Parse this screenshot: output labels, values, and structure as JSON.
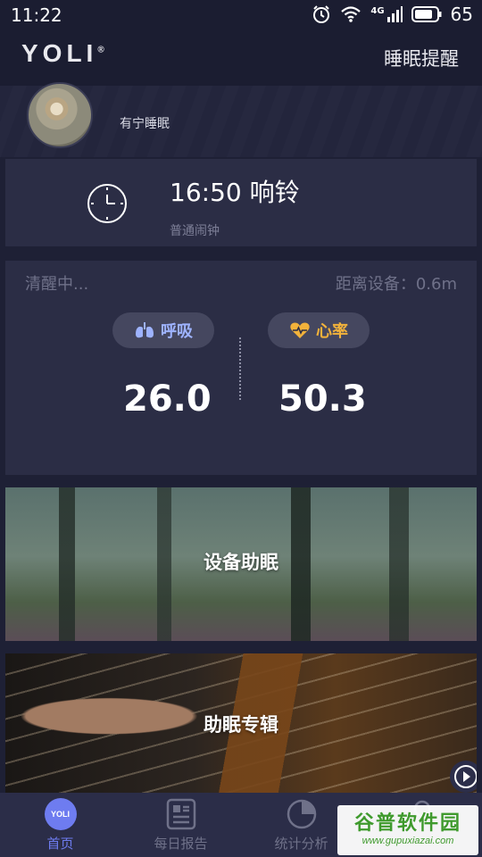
{
  "status_bar": {
    "time": "11:22",
    "network": "4G",
    "battery": "65",
    "icons": [
      "alarm-icon",
      "wifi-icon",
      "signal-icon",
      "battery-icon"
    ]
  },
  "header": {
    "logo": "YOLI",
    "logo_mark": "®",
    "sleep_reminder": "睡眠提醒"
  },
  "profile": {
    "name": "有宁睡眠"
  },
  "alarm": {
    "time_label": "16:50 响铃",
    "type": "普通闹钟"
  },
  "vitals": {
    "status": "清醒中...",
    "distance": "距离设备：0.6m",
    "breath_label": "呼吸",
    "breath_value": "26.0",
    "heart_label": "心率",
    "heart_value": "50.3",
    "colors": {
      "breath": "#9eb3ff",
      "heart": "#f2b23b"
    }
  },
  "cards": {
    "device_sleep": "设备助眠",
    "album": "助眠专辑"
  },
  "nav": {
    "home": "首页",
    "home_icon_text": "YOLI",
    "daily_report": "每日报告",
    "stats": "统计分析",
    "accent": "#6e7cf0"
  },
  "watermark": {
    "name": "谷普软件园",
    "url": "www.gupuxiazai.com"
  }
}
